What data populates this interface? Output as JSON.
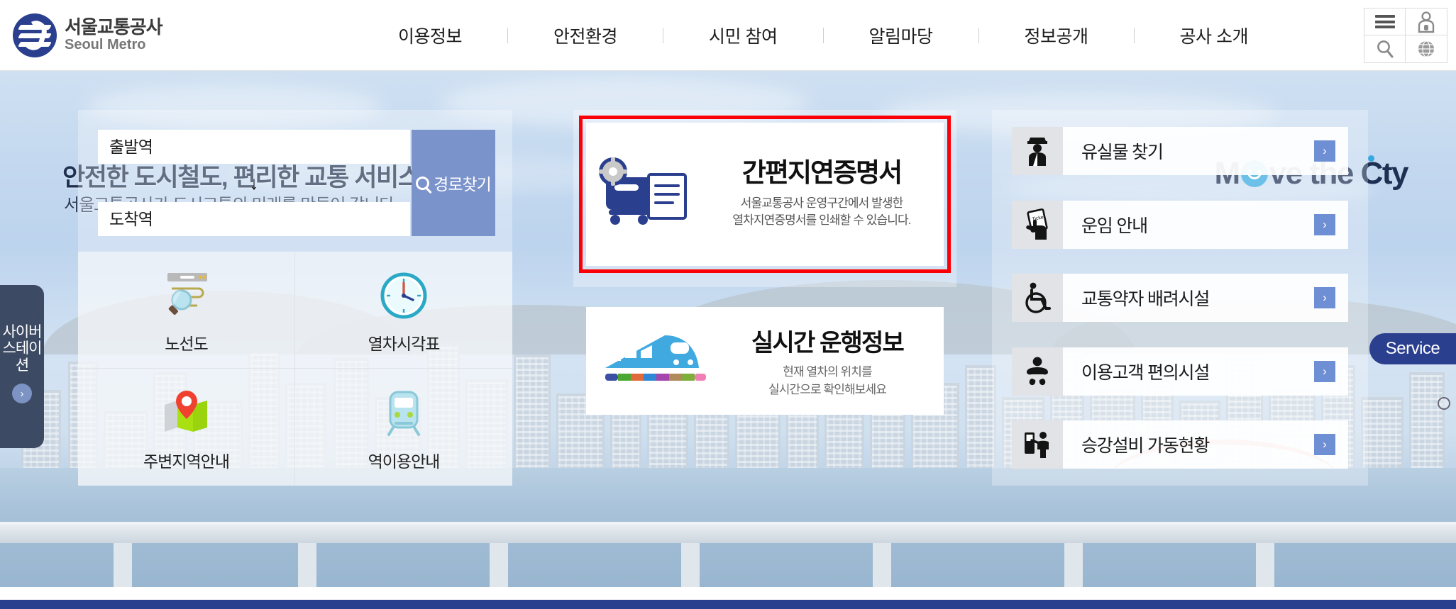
{
  "header": {
    "logo": {
      "ko": "서울교통공사",
      "en": "Seoul Metro"
    },
    "nav": [
      {
        "label": "이용정보"
      },
      {
        "label": "안전환경"
      },
      {
        "label": "시민 참여"
      },
      {
        "label": "알림마당"
      },
      {
        "label": "정보공개"
      },
      {
        "label": "공사 소개"
      }
    ],
    "icons": [
      {
        "name": "menu-icon"
      },
      {
        "name": "user-account-icon"
      },
      {
        "name": "search-icon"
      },
      {
        "name": "globe-language-icon"
      }
    ]
  },
  "hero": {
    "title": "안전한 도시철도, 편리한 교통 서비스",
    "subtitle": "서울교통공사가 도시교통의 미래를 만들어 갑니다.",
    "brand_slogan": {
      "part1": "M",
      "part2": "ve the C",
      "part3": "ty"
    }
  },
  "route_search": {
    "departure_placeholder": "출발역",
    "departure_value": "",
    "arrival_placeholder": "도착역",
    "arrival_value": "",
    "arrow": "↓",
    "button_label": "경로찾기"
  },
  "quick_links": [
    {
      "label": "노선도",
      "icon": "route-map-icon"
    },
    {
      "label": "열차시각표",
      "icon": "clock-icon"
    },
    {
      "label": "주변지역안내",
      "icon": "map-pin-icon"
    },
    {
      "label": "역이용안내",
      "icon": "train-icon"
    }
  ],
  "cards": {
    "certificate": {
      "title": "간편지연증명서",
      "desc_line1": "서울교통공사 운영구간에서 발생한",
      "desc_line2": "열차지연증명서를 인쇄할 수 있습니다.",
      "highlight_color": "#fb0007"
    },
    "realtime": {
      "title": "실시간 운행정보",
      "desc_line1": "현재 열차의 위치를",
      "desc_line2": "실시간으로 확인해보세요"
    }
  },
  "right_links": [
    {
      "label": "유실물 찾기",
      "icon": "station-staff-icon",
      "arrow": "›"
    },
    {
      "label": "운임 안내",
      "icon": "ticket-hand-icon",
      "arrow": "›"
    },
    {
      "label": "교통약자 배려시설",
      "icon": "wheelchair-icon",
      "arrow": "›"
    },
    {
      "label": "이용고객 편의시설",
      "icon": "baby-care-icon",
      "arrow": "›"
    },
    {
      "label": "승강설비 가동현황",
      "icon": "elevator-person-icon",
      "arrow": "›"
    }
  ],
  "side_tabs": {
    "cyber_station": {
      "label": "사이버스테이션",
      "button": "›"
    },
    "service": {
      "label": "Service"
    }
  },
  "colors": {
    "brand_navy": "#2b3f8f",
    "accent_blue": "#7b93cb",
    "highlight_red": "#fb0007",
    "arrow_blue": "#6f8fd4"
  }
}
